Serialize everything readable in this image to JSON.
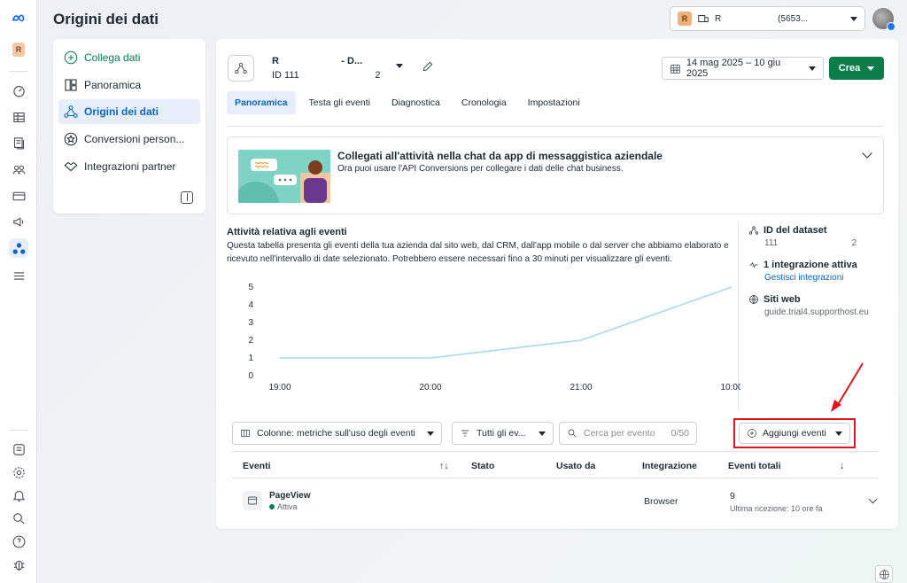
{
  "header": {
    "title": "Origini dei dati",
    "account_badge": "R",
    "account_text": "R            (5653..."
  },
  "rail": {
    "avatar_letter": "R",
    "icons": [
      "meta-logo-icon",
      "dashboard-icon",
      "table-icon",
      "pages-icon",
      "people-icon",
      "billing-icon",
      "megaphone-icon",
      "events-manager-icon",
      "menu-icon",
      "news-icon",
      "settings-icon",
      "bell-icon",
      "search-icon",
      "help-icon",
      "bug-icon"
    ]
  },
  "sidebar": {
    "items": [
      {
        "label": "Collega dati",
        "icon": "plus-circle-icon"
      },
      {
        "label": "Panoramica",
        "icon": "overview-icon"
      },
      {
        "label": "Origini dei dati",
        "icon": "data-sources-icon"
      },
      {
        "label": "Conversioni person...",
        "icon": "star-badge-icon"
      },
      {
        "label": "Integrazioni partner",
        "icon": "handshake-icon"
      }
    ]
  },
  "dataset": {
    "name": "R            - D...",
    "id": "ID 111              2"
  },
  "toolbar": {
    "date_range": "14 mag 2025 – 10 giu 2025",
    "create_label": "Crea"
  },
  "tabs": [
    "Panoramica",
    "Testa gli eventi",
    "Diagnostica",
    "Cronologia",
    "Impostazioni"
  ],
  "banner": {
    "title": "Collegati all'attività nella chat da app di messaggistica aziendale",
    "subtitle": "Ora puoi usare l'API Conversions per collegare i dati delle chat business."
  },
  "activity": {
    "title": "Attività relativa agli eventi",
    "description": "Questa tabella presenta gli eventi della tua azienda dal sito web, dal CRM, dall'app mobile o dal server che abbiamo elaborato e ricevuto nell'intervallo di date selezionato. Potrebbero essere necessari fino a 30 minuti per visualizzare gli eventi."
  },
  "chart_data": {
    "type": "line",
    "x": [
      "19:00",
      "20:00",
      "21:00",
      "10:00"
    ],
    "series": [
      {
        "values": [
          1,
          1,
          2,
          5
        ]
      }
    ],
    "y_ticks": [
      0,
      1,
      2,
      3,
      4,
      5
    ],
    "ylim": [
      0,
      5
    ],
    "grid": false,
    "line_color": "#a9d8f2"
  },
  "meta": {
    "dataset_label": "ID del dataset",
    "dataset_value": "111               2",
    "integration_label": "1 integrazione attiva",
    "integration_link": "Gestisci integrazioni",
    "sites_label": "Siti web",
    "sites_value": "guide.trial4.supporthost.eu"
  },
  "filters": {
    "columns": "Colonne: metriche sull'uso degli eventi",
    "events_filter": "Tutti gli ev...",
    "search_placeholder": "Cerca per evento",
    "search_count": "0/50",
    "add_events": "Aggiungi eventi"
  },
  "table": {
    "headers": [
      "Eventi",
      "Stato",
      "Usato da",
      "Integrazione",
      "Eventi totali"
    ],
    "rows": [
      {
        "name": "PageView",
        "status": "Attiva",
        "integration": "Browser",
        "total": "9",
        "last": "Ultima ricezione: 10 ore fa"
      }
    ]
  },
  "colors": {
    "accent": "#0a66c2",
    "create": "#0a7d4a",
    "highlight": "#e0151d"
  }
}
